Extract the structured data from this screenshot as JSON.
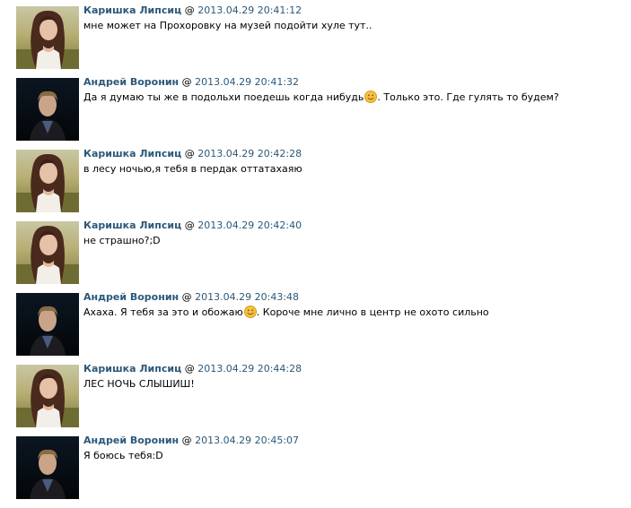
{
  "separator": "@",
  "avatar_female": "girl-portrait-avatar",
  "avatar_male": "boy-portrait-avatar",
  "smiley_icon": "smiling-face-icon",
  "colors": {
    "author": "#2b587a",
    "timestamp": "#2b587a",
    "text": "#000000",
    "smiley": "#f5c242"
  },
  "messages": [
    {
      "author": "Каришка Липсиц",
      "timestamp": "2013.04.29 20:41:12",
      "text": "мне может на Прохоровку на музей подойти хуле тут..",
      "text_after": ""
    },
    {
      "author": "Андрей Воронин",
      "timestamp": "2013.04.29 20:41:32",
      "text": "Да я думаю ты же в подольхи поедешь когда нибудь",
      "text_after": ". Только это. Где гулять то будем?"
    },
    {
      "author": "Каришка Липсиц",
      "timestamp": "2013.04.29 20:42:28",
      "text": "в лесу ночью,я тебя в пердак оттатахаяю",
      "text_after": ""
    },
    {
      "author": "Каришка Липсиц",
      "timestamp": "2013.04.29 20:42:40",
      "text": "не страшно?;D",
      "text_after": ""
    },
    {
      "author": "Андрей Воронин",
      "timestamp": "2013.04.29 20:43:48",
      "text": "Ахаха. Я тебя за это и обожаю",
      "text_after": ". Короче мне лично в центр не охото сильно"
    },
    {
      "author": "Каришка Липсиц",
      "timestamp": "2013.04.29 20:44:28",
      "text": "ЛЕС НОЧЬ СЛЫШИШ!",
      "text_after": ""
    },
    {
      "author": "Андрей Воронин",
      "timestamp": "2013.04.29 20:45:07",
      "text": "Я боюсь тебя:D",
      "text_after": ""
    }
  ]
}
